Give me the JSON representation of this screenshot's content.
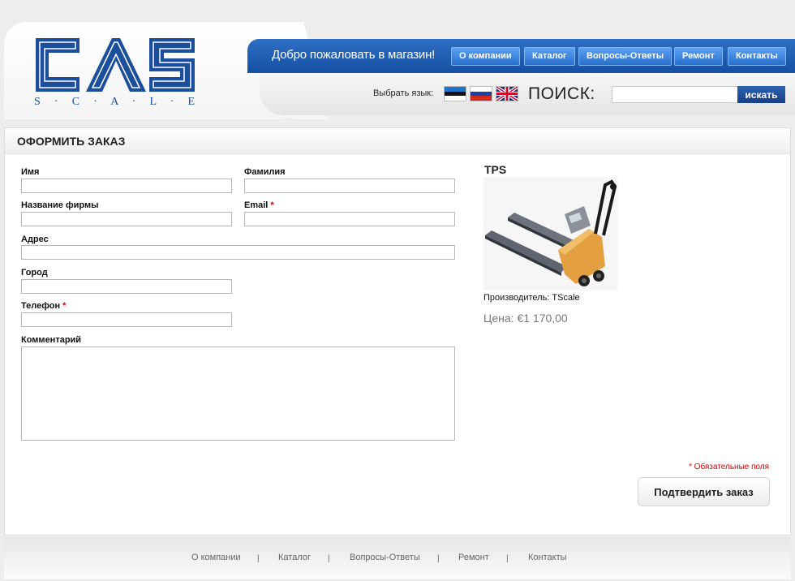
{
  "brand": {
    "logo_text": "CAS",
    "logo_sub": "S · C · A · L · E",
    "colors": {
      "primary": "#1b4f9c",
      "nav": "#1e5cb3",
      "required": "#dd0000"
    }
  },
  "header": {
    "welcome": "Добро пожаловать в магазин!",
    "nav": [
      "О компании",
      "Каталог",
      "Вопросы-Ответы",
      "Ремонт",
      "Контакты"
    ],
    "lang_label": "Выбрать язык:",
    "languages": [
      "estonian-flag-icon",
      "russian-flag-icon",
      "uk-flag-icon"
    ],
    "search_label": "ПОИСК:",
    "search_value": "",
    "search_button": "искать"
  },
  "main": {
    "title": "ОФОРМИТЬ ЗАКАЗ",
    "form": {
      "first_name": {
        "label": "Имя",
        "value": ""
      },
      "last_name": {
        "label": "Фамилия",
        "value": ""
      },
      "company": {
        "label": "Название фирмы",
        "value": ""
      },
      "email": {
        "label": "Email",
        "required": "*",
        "value": ""
      },
      "address": {
        "label": "Адрес",
        "value": ""
      },
      "city": {
        "label": "Город",
        "value": ""
      },
      "phone": {
        "label": "Телефон",
        "required": "*",
        "value": ""
      },
      "comment": {
        "label": "Комментарий",
        "value": ""
      }
    },
    "product": {
      "name": "TPS",
      "manufacturer": "Производитель: TScale",
      "price": "Цена: €1 170,00"
    },
    "required_note": "* Обязательные поля",
    "submit_label": "Подтвердить заказ"
  },
  "footer": {
    "links": [
      "О компании",
      "Каталог",
      "Вопросы-Ответы",
      "Ремонт",
      "Контакты"
    ],
    "separator": "|"
  }
}
